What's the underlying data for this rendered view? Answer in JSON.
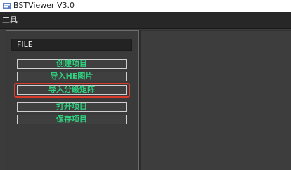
{
  "window": {
    "title": "BSTViewer V3.0",
    "icon": "app-logo-icon"
  },
  "menubar": {
    "items": [
      {
        "label": "工具"
      }
    ]
  },
  "panel": {
    "header": "FILE",
    "buttons": [
      {
        "label": "创建项目"
      },
      {
        "label": "导入HE图片"
      },
      {
        "label": "导入分级矩阵",
        "highlighted": true
      },
      {
        "label": "打开项目"
      },
      {
        "label": "保存项目"
      }
    ]
  },
  "colors": {
    "button_text": "#2fd07f",
    "highlight": "#d83a2c",
    "background": "#3b3b3b",
    "menubar": "#272727"
  }
}
